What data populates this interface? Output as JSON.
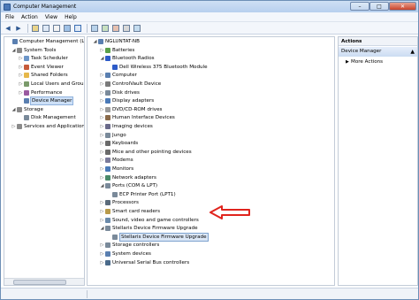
{
  "window": {
    "title": "Computer Management",
    "close_glyph": "✕",
    "min_glyph": "–",
    "max_glyph": "□"
  },
  "menu": [
    "File",
    "Action",
    "View",
    "Help"
  ],
  "toolbar": {
    "back_glyph": "◀",
    "forward_glyph": "▶"
  },
  "colors": {
    "arrow": "#e0241d",
    "selection": "#cde0f7",
    "accent": "#3c6fb3"
  },
  "left_tree": [
    {
      "label": "Computer Management (Local",
      "x": 3,
      "tw": "",
      "icon": "computer-icon",
      "c": "#5a7fb0"
    },
    {
      "label": "System Tools",
      "x": 8,
      "tw": "◢",
      "icon": "tools-icon",
      "c": "#8a8a8a"
    },
    {
      "label": "Task Scheduler",
      "x": 16,
      "tw": "▷",
      "icon": "clock-icon",
      "c": "#6d96c8"
    },
    {
      "label": "Event Viewer",
      "x": 16,
      "tw": "▷",
      "icon": "event-viewer-icon",
      "c": "#c65a3a"
    },
    {
      "label": "Shared Folders",
      "x": 16,
      "tw": "▷",
      "icon": "folder-icon",
      "c": "#e6b84a"
    },
    {
      "label": "Local Users and Groups",
      "x": 16,
      "tw": "▷",
      "icon": "users-icon",
      "c": "#7a9a6a"
    },
    {
      "label": "Performance",
      "x": 16,
      "tw": "▷",
      "icon": "performance-icon",
      "c": "#9a5aa0"
    },
    {
      "label": "Device Manager",
      "x": 16,
      "tw": "",
      "icon": "device-manager-icon",
      "c": "#5a7fb0",
      "selected": true
    },
    {
      "label": "Storage",
      "x": 8,
      "tw": "◢",
      "icon": "storage-icon",
      "c": "#8a8a8a"
    },
    {
      "label": "Disk Management",
      "x": 16,
      "tw": "",
      "icon": "disk-icon",
      "c": "#7a8a9a"
    },
    {
      "label": "Services and Applications",
      "x": 8,
      "tw": "▷",
      "icon": "services-icon",
      "c": "#8a8a8a"
    }
  ],
  "device_tree": [
    {
      "label": "NGLUNTAT-NB",
      "x": 6,
      "tw": "◢",
      "icon": "computer-icon",
      "c": "#5a7fb0"
    },
    {
      "label": "Batteries",
      "x": 14,
      "tw": "▷",
      "icon": "battery-icon",
      "c": "#5aa04a"
    },
    {
      "label": "Bluetooth Radios",
      "x": 14,
      "tw": "◢",
      "icon": "bluetooth-icon",
      "c": "#2d5bc8"
    },
    {
      "label": "Dell Wireless 375 Bluetooth Module",
      "x": 22,
      "tw": "",
      "icon": "bluetooth-icon",
      "c": "#2d5bc8"
    },
    {
      "label": "Computer",
      "x": 14,
      "tw": "▷",
      "icon": "computer-icon",
      "c": "#5a7fb0"
    },
    {
      "label": "ControlVault Device",
      "x": 14,
      "tw": "▷",
      "icon": "security-device-icon",
      "c": "#7a7a7a"
    },
    {
      "label": "Disk drives",
      "x": 14,
      "tw": "▷",
      "icon": "disk-icon",
      "c": "#7a8a9a"
    },
    {
      "label": "Display adapters",
      "x": 14,
      "tw": "▷",
      "icon": "display-icon",
      "c": "#4a7ab8"
    },
    {
      "label": "DVD/CD-ROM drives",
      "x": 14,
      "tw": "▷",
      "icon": "dvd-icon",
      "c": "#9a9a9a"
    },
    {
      "label": "Human Interface Devices",
      "x": 14,
      "tw": "▷",
      "icon": "hid-icon",
      "c": "#8a6a4a"
    },
    {
      "label": "Imaging devices",
      "x": 14,
      "tw": "▷",
      "icon": "camera-icon",
      "c": "#6a6a8a"
    },
    {
      "label": "Jungo",
      "x": 14,
      "tw": "▷",
      "icon": "device-icon",
      "c": "#7a8a9a"
    },
    {
      "label": "Keyboards",
      "x": 14,
      "tw": "▷",
      "icon": "keyboard-icon",
      "c": "#6a6a6a"
    },
    {
      "label": "Mice and other pointing devices",
      "x": 14,
      "tw": "▷",
      "icon": "mouse-icon",
      "c": "#6a6a6a"
    },
    {
      "label": "Modems",
      "x": 14,
      "tw": "▷",
      "icon": "modem-icon",
      "c": "#7a7a9a"
    },
    {
      "label": "Monitors",
      "x": 14,
      "tw": "▷",
      "icon": "monitor-icon",
      "c": "#4a7ab8"
    },
    {
      "label": "Network adapters",
      "x": 14,
      "tw": "▷",
      "icon": "network-icon",
      "c": "#4a8a6a"
    },
    {
      "label": "Ports (COM & LPT)",
      "x": 14,
      "tw": "◢",
      "icon": "port-icon",
      "c": "#7a8a9a"
    },
    {
      "label": "ECP Printer Port (LPT1)",
      "x": 22,
      "tw": "",
      "icon": "port-icon",
      "c": "#7a8a9a"
    },
    {
      "label": "Processors",
      "x": 14,
      "tw": "▷",
      "icon": "processor-icon",
      "c": "#5a6a7a"
    },
    {
      "label": "Smart card readers",
      "x": 14,
      "tw": "▷",
      "icon": "smart-card-icon",
      "c": "#b89a4a"
    },
    {
      "label": "Sound, video and game controllers",
      "x": 14,
      "tw": "▷",
      "icon": "sound-icon",
      "c": "#6a8aaa"
    },
    {
      "label": "Stellaris Device Firmware Upgrade",
      "x": 14,
      "tw": "◢",
      "icon": "device-icon",
      "c": "#7a8a9a"
    },
    {
      "label": "Stellaris Device Firmware Upgrade",
      "x": 22,
      "tw": "",
      "icon": "device-icon",
      "c": "#7a8a9a",
      "highlight": true
    },
    {
      "label": "Storage controllers",
      "x": 14,
      "tw": "▷",
      "icon": "storage-controller-icon",
      "c": "#7a8a9a"
    },
    {
      "label": "System devices",
      "x": 14,
      "tw": "▷",
      "icon": "system-icon",
      "c": "#5a7fb0"
    },
    {
      "label": "Universal Serial Bus controllers",
      "x": 14,
      "tw": "▷",
      "icon": "usb-icon",
      "c": "#4a6a8a"
    }
  ],
  "actions": {
    "header": "Actions",
    "section": "Device Manager",
    "section_arrow": "▲",
    "more": "More Actions",
    "more_arrow": "▶"
  }
}
